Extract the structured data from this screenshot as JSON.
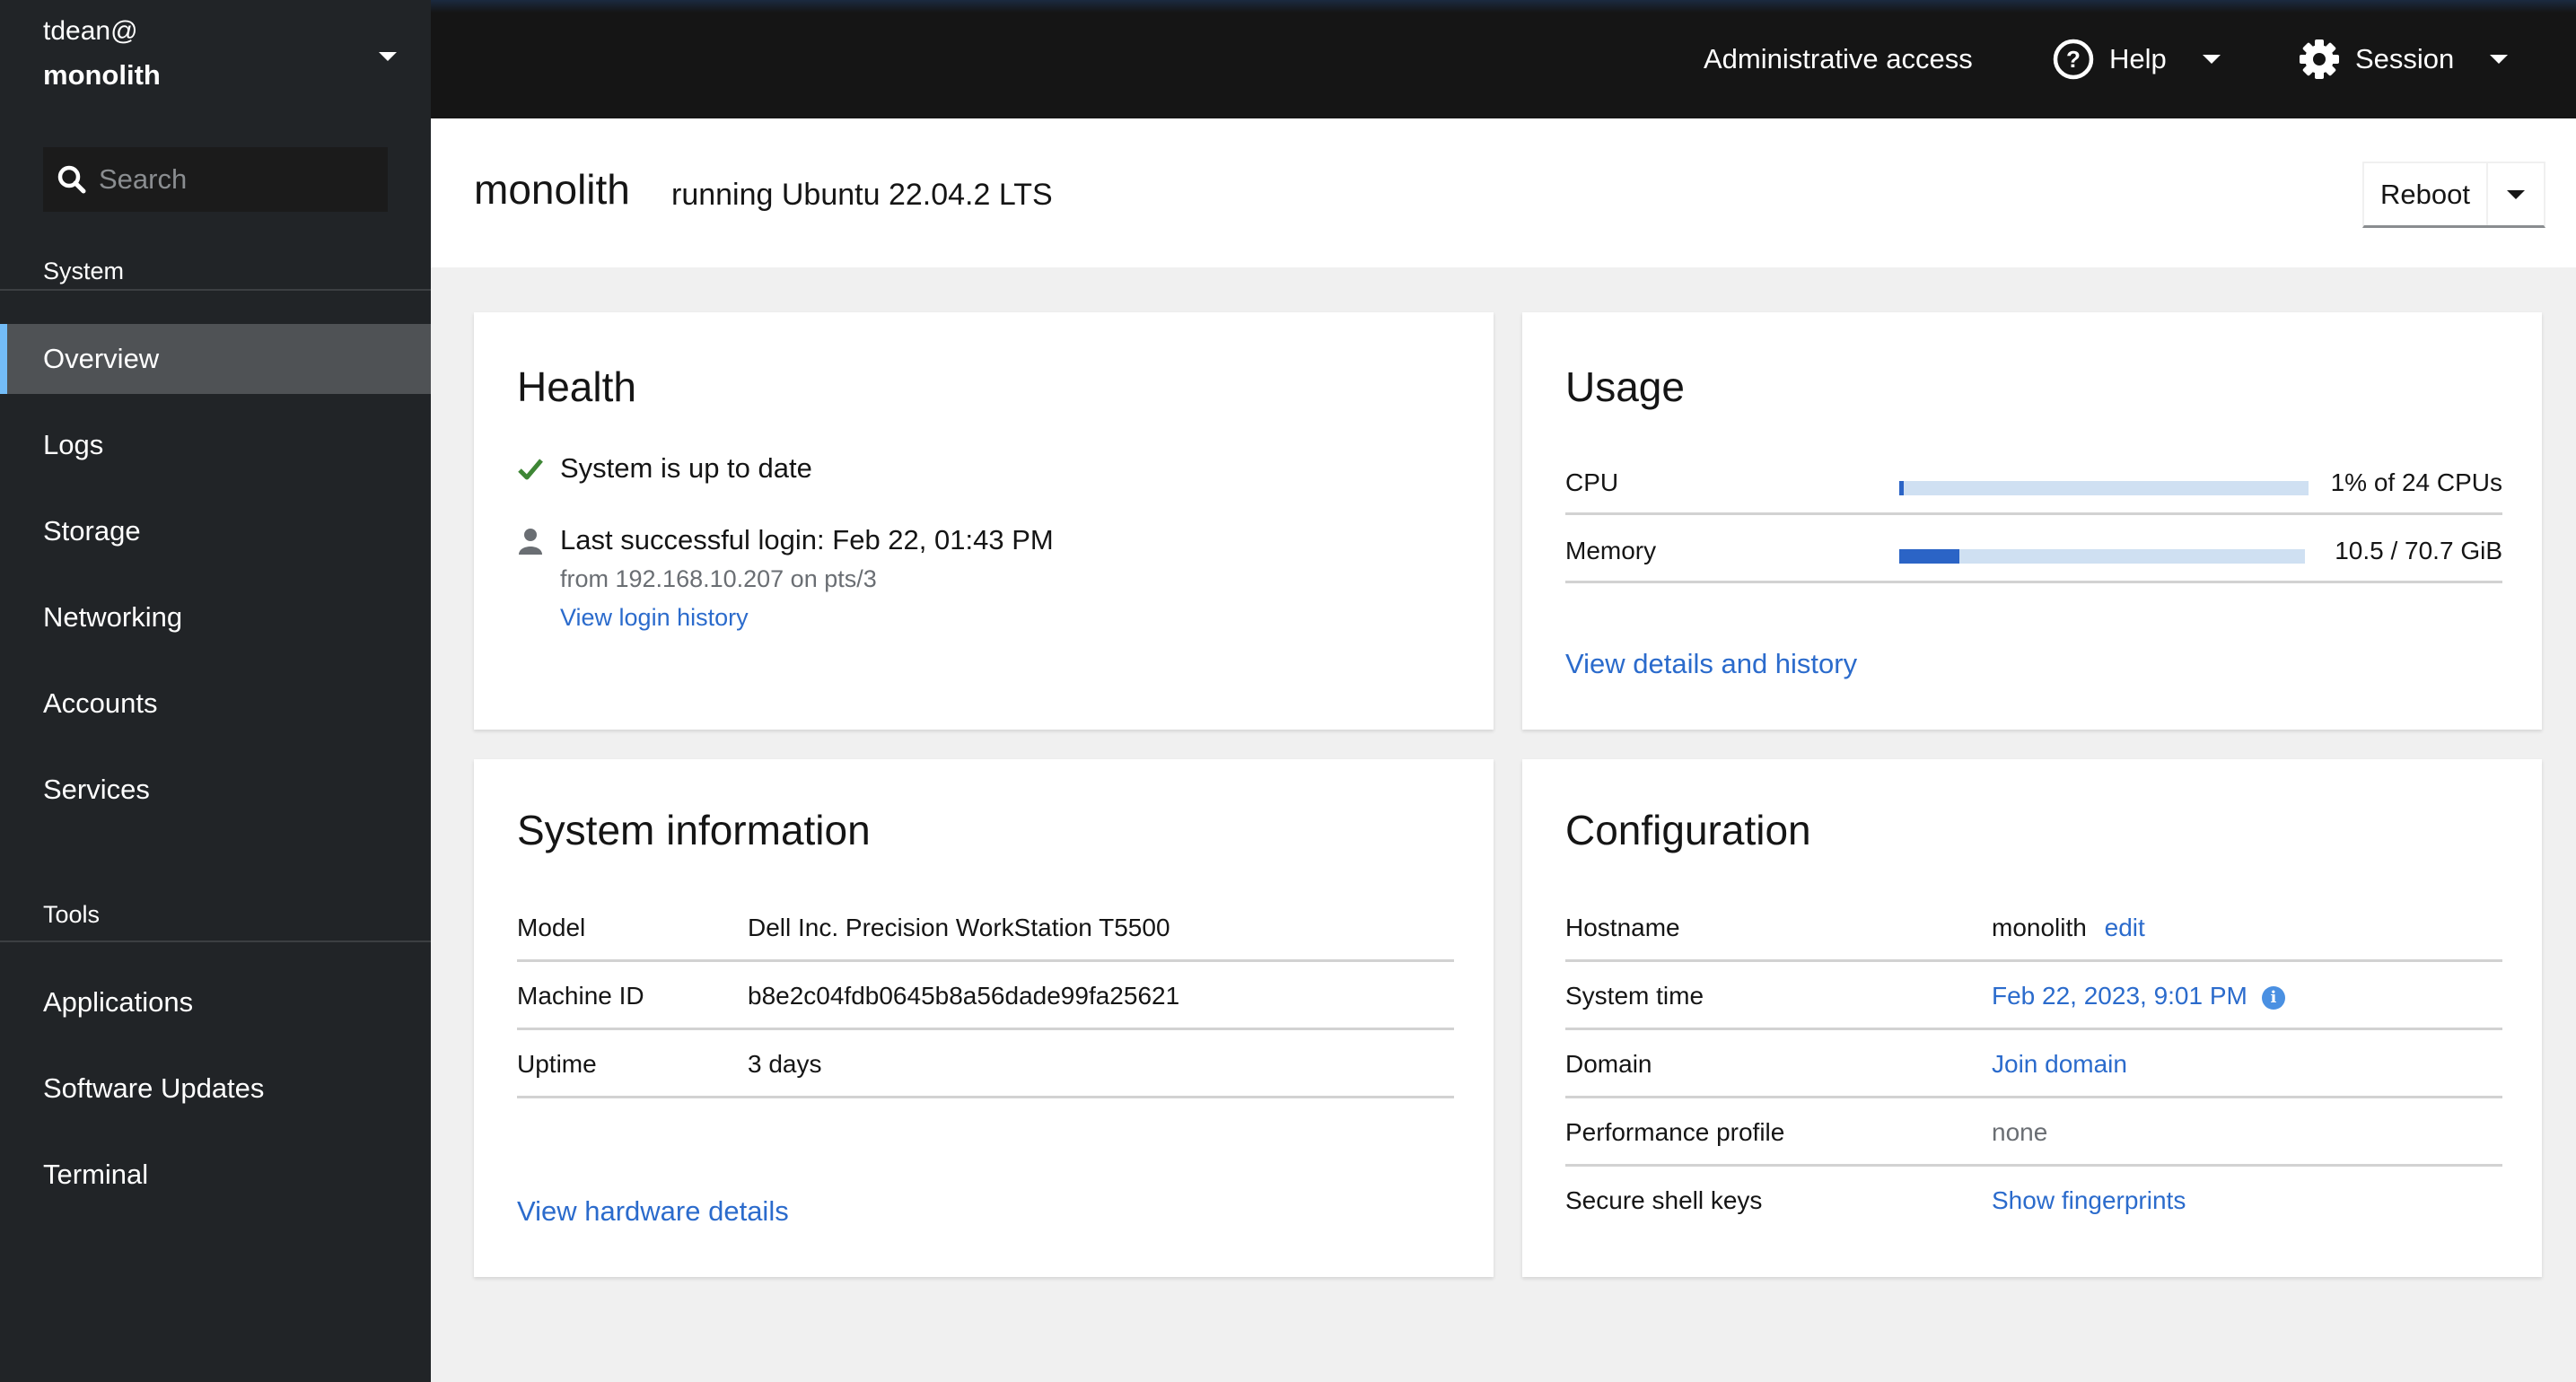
{
  "host_switcher": {
    "user": "tdean@",
    "host": "monolith"
  },
  "search": {
    "placeholder": "Search",
    "value": ""
  },
  "sidebar": {
    "sections": [
      {
        "title": "System",
        "items": [
          {
            "label": "Overview",
            "active": true
          },
          {
            "label": "Logs"
          },
          {
            "label": "Storage"
          },
          {
            "label": "Networking"
          },
          {
            "label": "Accounts"
          },
          {
            "label": "Services"
          }
        ]
      },
      {
        "title": "Tools",
        "items": [
          {
            "label": "Applications"
          },
          {
            "label": "Software Updates"
          },
          {
            "label": "Terminal"
          }
        ]
      }
    ]
  },
  "topbar": {
    "admin_access": "Administrative access",
    "help": "Help",
    "session": "Session"
  },
  "page": {
    "title": "monolith",
    "subtitle": "running Ubuntu 22.04.2 LTS",
    "reboot_label": "Reboot"
  },
  "health": {
    "title": "Health",
    "status": "System is up to date",
    "last_login": "Last successful login: Feb 22, 01:43 PM",
    "login_from": "from 192.168.10.207 on pts/3",
    "login_history_link": "View login history"
  },
  "usage": {
    "title": "Usage",
    "rows": [
      {
        "label": "CPU",
        "value": "1% of 24 CPUs",
        "fraction": 0.01
      },
      {
        "label": "Memory",
        "value": "10.5 / 70.7 GiB",
        "fraction": 0.1485
      }
    ],
    "details_link": "View details and history"
  },
  "system_info": {
    "title": "System information",
    "rows": [
      {
        "label": "Model",
        "value": "Dell Inc. Precision WorkStation T5500"
      },
      {
        "label": "Machine ID",
        "value": "b8e2c04fdb0645b8a56dade99fa25621"
      },
      {
        "label": "Uptime",
        "value": "3 days"
      }
    ],
    "hardware_link": "View hardware details"
  },
  "configuration": {
    "title": "Configuration",
    "rows": [
      {
        "label": "Hostname",
        "value": "monolith",
        "link": "edit"
      },
      {
        "label": "System time",
        "link": "Feb 22, 2023, 9:01 PM"
      },
      {
        "label": "Domain",
        "link": "Join domain"
      },
      {
        "label": "Performance profile",
        "value": "none"
      },
      {
        "label": "Secure shell keys",
        "link": "Show fingerprints"
      }
    ]
  },
  "colors": {
    "accent_link": "#2b6bcc",
    "success": "#3e8635",
    "nav_active_indicator": "#73bcf7",
    "usage_fill": "#2b64c6",
    "usage_track": "#cfe0f2"
  }
}
